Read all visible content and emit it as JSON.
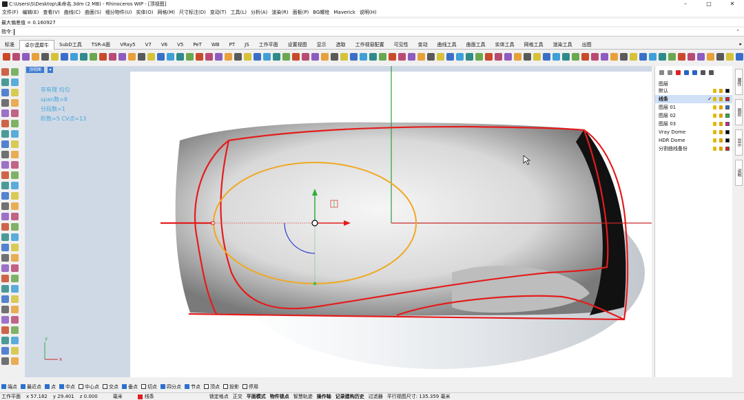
{
  "window": {
    "title": "C:\\Users\\S\\Desktop\\未命名.3dm (2 MB) - Rhinoceros WIP - [顶视图]",
    "min": "–",
    "max": "□",
    "close": "✕"
  },
  "menu": [
    "文件(F)",
    "编辑(E)",
    "查看(V)",
    "曲线(C)",
    "曲面(S)",
    "细分物件(U)",
    "实体(O)",
    "网格(M)",
    "尺寸标注(D)",
    "变动(T)",
    "工具(L)",
    "分析(A)",
    "渲染(R)",
    "面板(P)",
    "BG螺栓",
    "Maverick",
    "说明(H)"
  ],
  "command": {
    "history": "最大偏差值 = 0.160927",
    "prompt": "指令:"
  },
  "tabs": [
    "标准",
    "卓尔谟犀牛",
    "SubD工具",
    "TSR-A面",
    "VRay5",
    "V7",
    "V6",
    "V5",
    "PeT",
    "WB",
    "PT",
    "JS",
    "工作平面",
    "设置视图",
    "显示",
    "选取",
    "工作视窗配置",
    "可见性",
    "变动",
    "曲线工具",
    "曲面工具",
    "实体工具",
    "网格工具",
    "渲染工具",
    "出图"
  ],
  "active_tab": "卓尔谟犀牛",
  "viewport": {
    "label": "顶视图",
    "notes": [
      "非有理 均匀",
      "span数=8",
      "分段数=1",
      "阶数=5 CV点=13"
    ],
    "axis_x": "x",
    "axis_y": "y"
  },
  "layers": {
    "header": "图层",
    "items": [
      {
        "name": "默认",
        "color": "#000000",
        "current": false
      },
      {
        "name": "线条",
        "color": "#e41c1c",
        "current": true
      },
      {
        "name": "图层 01",
        "color": "#1f6fd6",
        "current": false
      },
      {
        "name": "图层 02",
        "color": "#1fbf2a",
        "current": false
      },
      {
        "name": "图层 03",
        "color": "#d61f8a",
        "current": false
      },
      {
        "name": "Vray Dome",
        "color": "#000000",
        "current": false
      },
      {
        "name": "HDR Dome",
        "color": "#000000",
        "current": false
      },
      {
        "name": "分割曲线备份",
        "color": "#e41c1c",
        "current": false
      }
    ]
  },
  "sidetabs": [
    "属性",
    "图层",
    "显示",
    "说明"
  ],
  "snaps": [
    {
      "label": "端点",
      "on": true
    },
    {
      "label": "最近点",
      "on": true
    },
    {
      "label": "点",
      "on": true
    },
    {
      "label": "中点",
      "on": true
    },
    {
      "label": "中心点",
      "on": false
    },
    {
      "label": "交点",
      "on": false
    },
    {
      "label": "垂点",
      "on": true
    },
    {
      "label": "切点",
      "on": false
    },
    {
      "label": "四分点",
      "on": true
    },
    {
      "label": "节点",
      "on": true
    },
    {
      "label": "顶点",
      "on": false
    },
    {
      "label": "投影",
      "on": false
    },
    {
      "label": "停用",
      "on": false
    }
  ],
  "status": {
    "cplane": "工作平面",
    "x": "x 57.182",
    "y": "y 29.401",
    "z": "z 0.000",
    "unit": "毫米",
    "layer": "线条",
    "toggles": [
      "锁定格点",
      "正交",
      "平面模式",
      "物件锁点",
      "智慧轨迹",
      "操作轴",
      "记录建构历史",
      "过滤器"
    ],
    "bold": [
      "平面模式",
      "物件锁点",
      "操作轴",
      "记录建构历史"
    ],
    "viewsize": "平行视图尺寸: 135.359 毫米"
  },
  "colors": {
    "curve_red": "#e41c1c",
    "ellipse": "#f0a820",
    "viewport_bg": "#cfd9e6",
    "accent": "#3c7ad0"
  },
  "icons": [
    "app-icon",
    "layer-visible-icon",
    "layer-lock-icon"
  ]
}
